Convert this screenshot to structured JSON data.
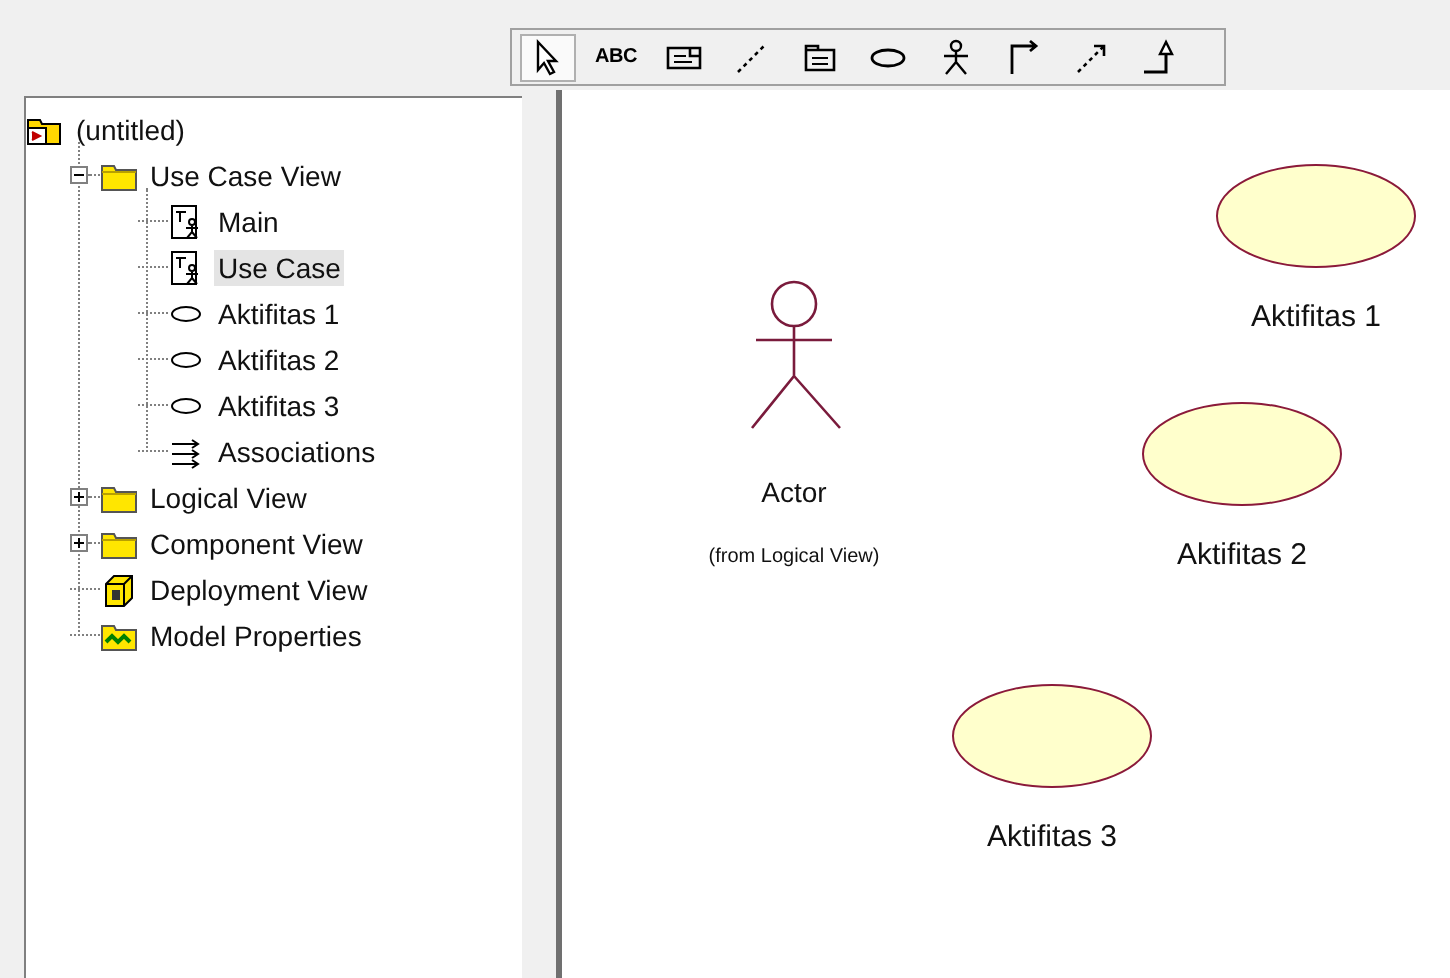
{
  "toolbar": {
    "tools": [
      {
        "kind": "pointer",
        "selected": true
      },
      {
        "kind": "text",
        "label": "ABC",
        "selected": false
      },
      {
        "kind": "note",
        "selected": false
      },
      {
        "kind": "anchor",
        "selected": false
      },
      {
        "kind": "package",
        "selected": false
      },
      {
        "kind": "usecase",
        "selected": false
      },
      {
        "kind": "actor",
        "selected": false
      },
      {
        "kind": "association",
        "selected": false
      },
      {
        "kind": "dependency",
        "selected": false
      },
      {
        "kind": "generalization",
        "selected": false
      }
    ]
  },
  "browser": {
    "tree": [
      {
        "label": "(untitled)",
        "kind": "model",
        "selected": false,
        "children": [
          {
            "label": "Use Case View",
            "kind": "folder",
            "expanded": true,
            "selected": false,
            "children": [
              {
                "label": "Main",
                "kind": "diagram",
                "selected": false
              },
              {
                "label": "Use Case",
                "kind": "diagram",
                "selected": true
              },
              {
                "label": "Aktifitas 1",
                "kind": "usecase",
                "selected": false
              },
              {
                "label": "Aktifitas 2",
                "kind": "usecase",
                "selected": false
              },
              {
                "label": "Aktifitas 3",
                "kind": "usecase",
                "selected": false
              },
              {
                "label": "Associations",
                "kind": "associations",
                "selected": false
              }
            ]
          },
          {
            "label": "Logical View",
            "kind": "folder",
            "expanded": false,
            "selected": false
          },
          {
            "label": "Component View",
            "kind": "folder",
            "expanded": false,
            "selected": false
          },
          {
            "label": "Deployment View",
            "kind": "deployment",
            "selected": false
          },
          {
            "label": "Model Properties",
            "kind": "properties",
            "selected": false
          }
        ]
      }
    ]
  },
  "diagram": {
    "actors": [
      {
        "name": "Actor",
        "note": "(from Logical View)"
      }
    ],
    "use_cases": [
      {
        "name": "Aktifitas 1"
      },
      {
        "name": "Aktifitas 2"
      },
      {
        "name": "Aktifitas 3"
      }
    ]
  }
}
